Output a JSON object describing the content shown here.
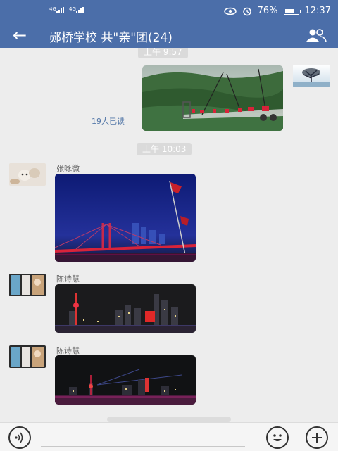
{
  "status_bar": {
    "sim1_label": "4G",
    "sim2_label": "4G",
    "battery_percent": "76%",
    "battery_level": 0.76,
    "time": "12:37",
    "icons": [
      "eye-icon",
      "alarm-icon",
      "battery-icon"
    ]
  },
  "header": {
    "back_icon": "arrow-left-icon",
    "title": "郧桥学校 共\"亲\"团(24)",
    "group_icon": "group-members-icon",
    "color": "#4b6ea9"
  },
  "chat": {
    "messages": [
      {
        "type": "time",
        "text": "上午 9:57"
      },
      {
        "type": "image",
        "side": "right",
        "sender": "",
        "image": "mountain-glass-bridge-photo",
        "read_status": "19人已读"
      },
      {
        "type": "time",
        "text": "上午 10:03"
      },
      {
        "type": "image",
        "side": "left",
        "sender": "张咏微",
        "image": "bridge-night-flag-photo"
      },
      {
        "type": "image",
        "side": "left",
        "sender": "陈诗慧",
        "image": "skyline-night-photo"
      },
      {
        "type": "image",
        "side": "left",
        "sender": "陈诗慧",
        "image": "skyline-night-lights-photo"
      }
    ]
  },
  "input_bar": {
    "voice_icon": "voice-icon",
    "emoji_icon": "emoji-icon",
    "more_icon": "plus-icon"
  }
}
